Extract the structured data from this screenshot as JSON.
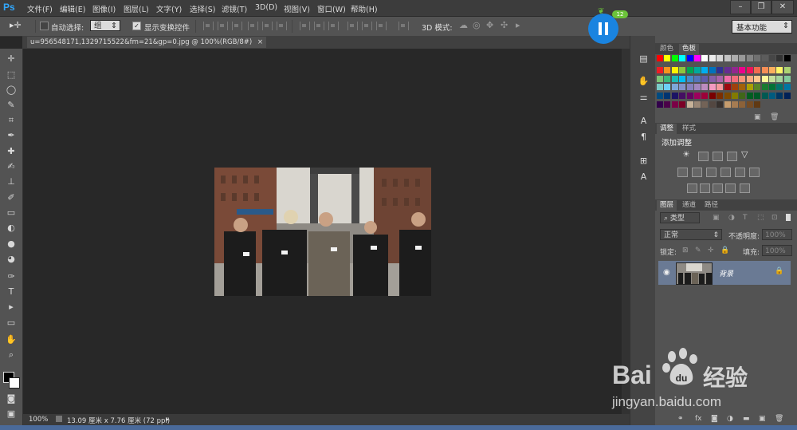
{
  "app": {
    "logo": "Ps"
  },
  "menu": [
    "文件(F)",
    "编辑(E)",
    "图像(I)",
    "图层(L)",
    "文字(Y)",
    "选择(S)",
    "滤镜(T)",
    "3D(D)",
    "视图(V)",
    "窗口(W)",
    "帮助(H)"
  ],
  "window_controls": {
    "minimize": "–",
    "restore": "❐",
    "close": "✕"
  },
  "options": {
    "auto_select_label": "自动选择:",
    "auto_select_value": "组",
    "show_transform_label": "显示变换控件",
    "mode_3d_label": "3D 模式:",
    "workspace": "基本功能"
  },
  "document": {
    "tab_title": "u=956548171,1329715522&fm=21&gp=0.jpg @ 100%(RGB/8#)",
    "tab_close": "×"
  },
  "status": {
    "zoom": "100%",
    "doc_info": "13.09 厘米 x 7.76 厘米 (72 ppi)"
  },
  "timer_badge": "12",
  "panels": {
    "color_tabs": [
      "颜色",
      "色板"
    ],
    "adjust_tabs": [
      "调整",
      "样式"
    ],
    "adjust_title": "添加调整",
    "layers_tabs": [
      "图层",
      "通道",
      "路径"
    ],
    "layer_filter": "类型",
    "blend_mode": "正常",
    "opacity_label": "不透明度:",
    "opacity_value": "100%",
    "lock_label": "锁定:",
    "fill_label": "填充:",
    "fill_value": "100%",
    "layer_name": "背景"
  },
  "watermark": {
    "brand": "Bai",
    "brand2": "经验",
    "url": "jingyan.baidu.com"
  },
  "colors": {
    "ps_blue": "#31a8ff",
    "timer_blue": "#1a84e0",
    "badge_green": "#6cc33a",
    "layer_highlight": "#6a7a94"
  }
}
